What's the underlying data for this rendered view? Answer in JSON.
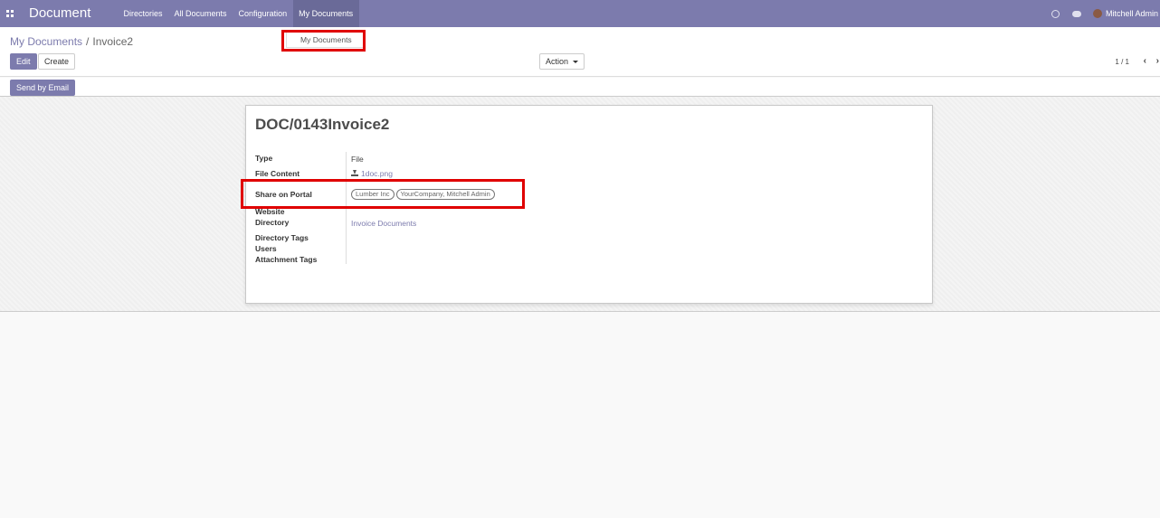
{
  "navbar": {
    "brand": "Document",
    "menu": [
      {
        "label": "Directories"
      },
      {
        "label": "All Documents"
      },
      {
        "label": "Configuration"
      },
      {
        "label": "My Documents"
      }
    ],
    "user": "Mitchell Admin"
  },
  "breadcrumb": {
    "parent": "My Documents",
    "separator": "/",
    "current": "Invoice2"
  },
  "toolbar": {
    "edit_label": "Edit",
    "create_label": "Create",
    "action_label": "Action",
    "pager": "1 / 1",
    "prev": "‹",
    "next": "›"
  },
  "dropdown_hint": "My Documents",
  "statusbar": {
    "send_email_label": "Send by Email"
  },
  "form": {
    "title": "DOC/0143Invoice2",
    "fields": {
      "type_label": "Type",
      "type_value": "File",
      "file_content_label": "File Content",
      "file_content_value": "1doc.png",
      "share_label": "Share on Portal",
      "share_tags": [
        "Lumber Inc",
        "YourCompany, Mitchell Admin"
      ],
      "website_label": "Website",
      "directory_label": "Directory",
      "directory_value": "Invoice Documents",
      "directory_tags_label": "Directory Tags",
      "users_label": "Users",
      "attachment_tags_label": "Attachment Tags"
    }
  },
  "colors": {
    "brand": "#7c7bad",
    "highlight": "#e00000"
  }
}
